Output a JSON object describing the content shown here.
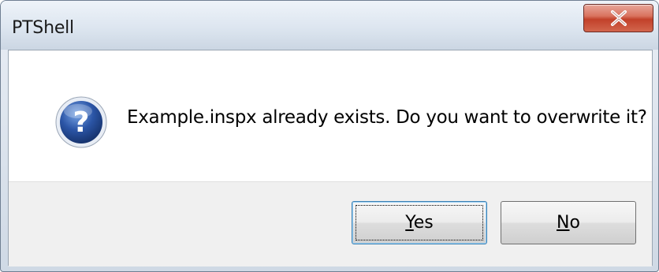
{
  "window": {
    "title": "PTShell"
  },
  "titlebar": {
    "close_icon": "close-x-icon"
  },
  "dialog": {
    "icon": "question-icon",
    "message": "Example.inspx already exists. Do you want to overwrite it?"
  },
  "buttons": {
    "yes": {
      "accel": "Y",
      "rest": "es"
    },
    "no": {
      "accel": "N",
      "rest": "o"
    }
  },
  "colors": {
    "close_button": "#c2412a",
    "question_icon": "#2b55a6",
    "default_button_border": "#3c7fb1"
  }
}
